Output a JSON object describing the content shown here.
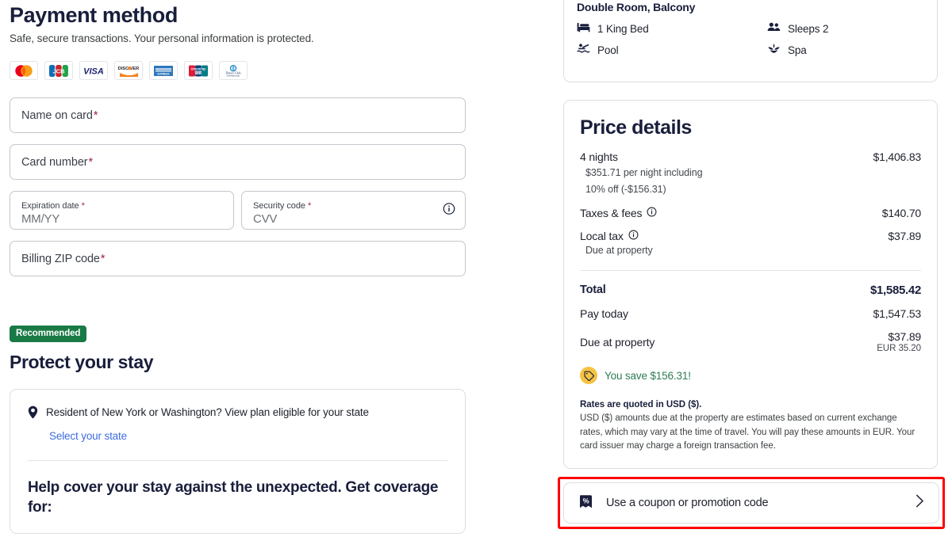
{
  "payment": {
    "title": "Payment method",
    "subtitle": "Safe, secure transactions. Your personal information is protected.",
    "card_logos": [
      {
        "name": "mastercard-logo",
        "label": "Mastercard"
      },
      {
        "name": "jcb-logo",
        "label": "JCB"
      },
      {
        "name": "visa-logo",
        "label": "VISA"
      },
      {
        "name": "discover-logo",
        "label": "DISCOVER"
      },
      {
        "name": "amex-logo",
        "label": "American Express"
      },
      {
        "name": "unionpay-logo",
        "label": "UnionPay"
      },
      {
        "name": "diners-club-logo",
        "label": "Diners Club"
      }
    ],
    "fields": {
      "name_on_card": {
        "label": "Name on card",
        "required_mark": "*",
        "value": ""
      },
      "card_number": {
        "label": "Card number",
        "required_mark": "*",
        "value": ""
      },
      "expiration": {
        "label": "Expiration date",
        "required_mark": "*",
        "placeholder": "MM/YY",
        "value": ""
      },
      "security_code": {
        "label": "Security code",
        "required_mark": "*",
        "placeholder": "CVV",
        "value": ""
      },
      "billing_zip": {
        "label": "Billing ZIP code",
        "required_mark": "*",
        "value": ""
      }
    }
  },
  "protect": {
    "badge": "Recommended",
    "title": "Protect your stay",
    "state_prompt": "Resident of New York or Washington? View plan eligible for your state",
    "state_link": "Select your state",
    "coverage_heading": "Help cover your stay against the unexpected. Get coverage for:"
  },
  "room": {
    "name": "Double Room, Balcony",
    "amenities": [
      {
        "icon": "bed-icon",
        "label": "1 King Bed"
      },
      {
        "icon": "people-icon",
        "label": "Sleeps 2"
      },
      {
        "icon": "pool-icon",
        "label": "Pool"
      },
      {
        "icon": "spa-icon",
        "label": "Spa"
      }
    ]
  },
  "price_details": {
    "title": "Price details",
    "nights_label": "4 nights",
    "nights_amount": "$1,406.83",
    "per_night_note": "$351.71 per night including",
    "discount_note": "10% off (-$156.31)",
    "taxes_label": "Taxes & fees",
    "taxes_amount": "$140.70",
    "local_tax_label": "Local tax",
    "local_tax_amount": "$37.89",
    "local_tax_note": "Due at property",
    "total_label": "Total",
    "total_amount": "$1,585.42",
    "pay_today_label": "Pay today",
    "pay_today_amount": "$1,547.53",
    "due_property_label": "Due at property",
    "due_property_amount": "$37.89",
    "due_property_eur": "EUR 35.20",
    "savings_text": "You save $156.31!",
    "rates_heading": "Rates are quoted in USD ($).",
    "rates_body": "USD ($) amounts due at the property are estimates based on current exchange rates, which may vary at the time of travel. You will pay these amounts in EUR. Your card issuer may charge a foreign transaction fee."
  },
  "coupon": {
    "label": "Use a coupon or promotion code"
  },
  "colors": {
    "accent_green": "#1a7a46",
    "discount_green": "#2e7d52",
    "link_blue": "#3e6ce0",
    "required_red": "#9e2146",
    "highlight_red": "#ff0000",
    "save_badge_yellow": "#f5c242",
    "text_dark": "#191e3b"
  }
}
